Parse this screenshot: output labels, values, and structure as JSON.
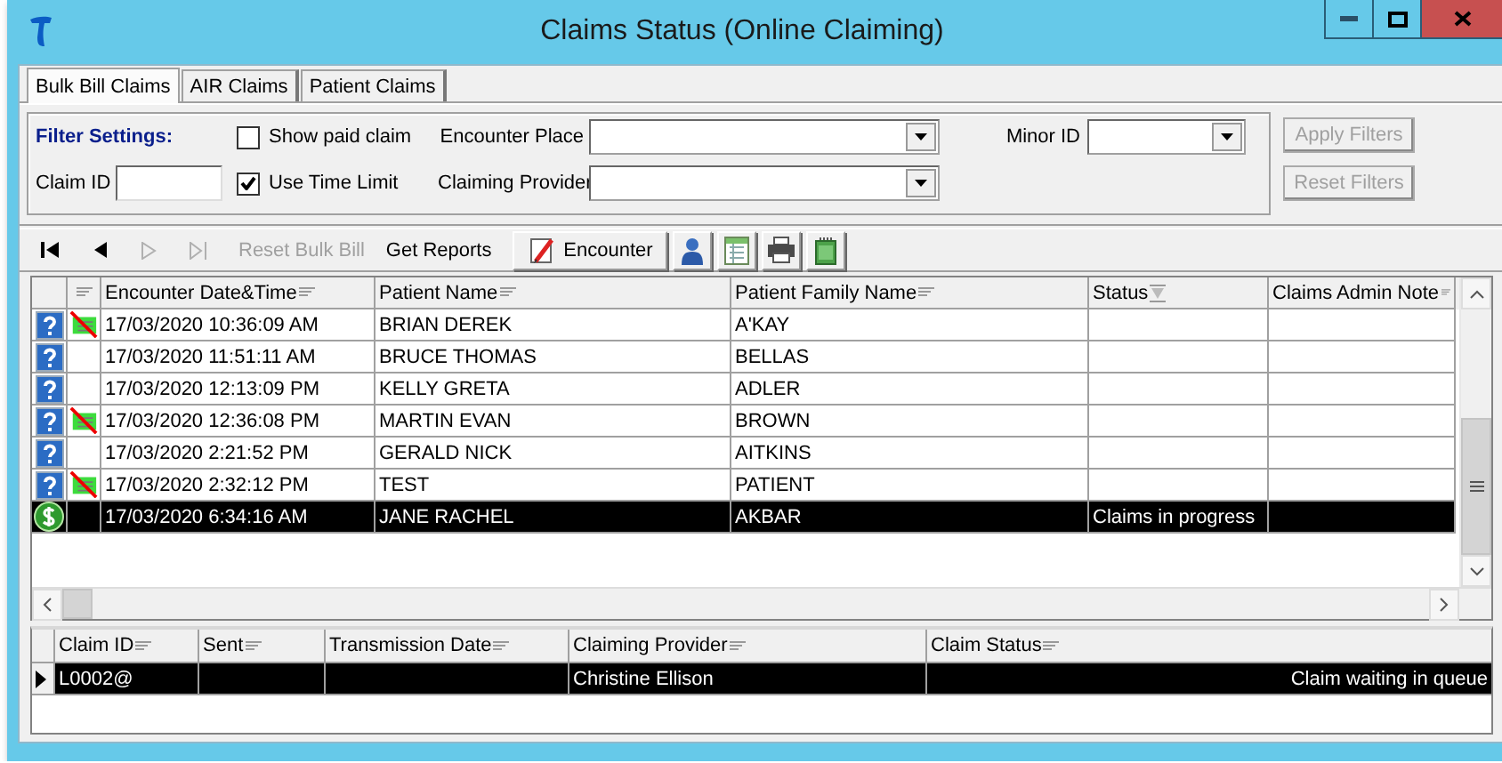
{
  "window": {
    "title": "Claims Status (Online Claiming)"
  },
  "tabs": [
    {
      "label": "Bulk Bill Claims",
      "selected": true
    },
    {
      "label": "AIR Claims",
      "selected": false
    },
    {
      "label": "Patient Claims",
      "selected": false
    }
  ],
  "filters": {
    "heading": "Filter Settings:",
    "checkboxes": [
      {
        "label": "Show paid claim",
        "checked": false
      },
      {
        "label": "Use Time Limit",
        "checked": true
      }
    ],
    "claim_id": {
      "label": "Claim ID"
    },
    "encounter_place": {
      "label": "Encounter Place"
    },
    "claiming_provider": {
      "label": "Claiming Provider"
    },
    "minor_id": {
      "label": "Minor ID"
    },
    "buttons": [
      {
        "label": "Apply Filters",
        "disabled": true
      },
      {
        "label": "Reset Filters",
        "disabled": true
      }
    ]
  },
  "toolbar": {
    "items": [
      {
        "kind": "first",
        "disabled": false
      },
      {
        "kind": "prev",
        "disabled": false
      },
      {
        "kind": "next",
        "disabled": true
      },
      {
        "kind": "last",
        "disabled": true
      },
      {
        "kind": "text",
        "label": "Reset Bulk Bill",
        "disabled": true
      },
      {
        "kind": "text",
        "label": "Get Reports",
        "disabled": false
      },
      {
        "kind": "encounter",
        "label": "Encounter",
        "disabled": false
      },
      {
        "kind": "person",
        "disabled": false
      },
      {
        "kind": "sheet",
        "disabled": false
      },
      {
        "kind": "printer",
        "disabled": false
      },
      {
        "kind": "card",
        "disabled": false
      }
    ]
  },
  "claims_grid": {
    "columns": [
      {
        "label": "Encounter Date&Time",
        "kind": "filter"
      },
      {
        "label": "Patient Name",
        "kind": "filter"
      },
      {
        "label": "Patient Family Name",
        "kind": "filter"
      },
      {
        "label": "Status",
        "kind": "sort"
      },
      {
        "label": "Claims Admin Note",
        "kind": "filter"
      }
    ],
    "rows": [
      {
        "kind": "unknown",
        "flagged": true,
        "selected": false,
        "encounter_date_time": "17/03/2020 10:36:09 AM",
        "patient_name": "BRIAN DEREK",
        "patient_family_name": "A'KAY"
      },
      {
        "kind": "unknown",
        "flagged": false,
        "selected": false,
        "encounter_date_time": "17/03/2020 11:51:11 AM",
        "patient_name": "BRUCE THOMAS",
        "patient_family_name": "BELLAS"
      },
      {
        "kind": "unknown",
        "flagged": false,
        "selected": false,
        "encounter_date_time": "17/03/2020 12:13:09 PM",
        "patient_name": "KELLY GRETA",
        "patient_family_name": "ADLER"
      },
      {
        "kind": "unknown",
        "flagged": true,
        "selected": false,
        "encounter_date_time": "17/03/2020 12:36:08 PM",
        "patient_name": "MARTIN EVAN",
        "patient_family_name": "BROWN"
      },
      {
        "kind": "unknown",
        "flagged": false,
        "selected": false,
        "encounter_date_time": "17/03/2020 2:21:52 PM",
        "patient_name": "GERALD NICK",
        "patient_family_name": "AITKINS"
      },
      {
        "kind": "unknown",
        "flagged": true,
        "selected": false,
        "encounter_date_time": "17/03/2020 2:32:12 PM",
        "patient_name": "TEST",
        "patient_family_name": "PATIENT"
      },
      {
        "kind": "paid",
        "flagged": false,
        "selected": true,
        "encounter_date_time": "17/03/2020 6:34:16 AM",
        "patient_name": "JANE RACHEL",
        "patient_family_name": "AKBAR",
        "status": "Claims in progress"
      }
    ]
  },
  "lines_grid": {
    "columns": [
      {
        "label": "Claim ID"
      },
      {
        "label": "Sent"
      },
      {
        "label": "Transmission Date"
      },
      {
        "label": "Claiming Provider"
      },
      {
        "label": "Claim Status"
      }
    ],
    "rows": [
      {
        "selected": true,
        "claim_id": "L0002@",
        "claiming_provider": "Christine Ellison",
        "claim_status": "Claim waiting in queue"
      }
    ]
  }
}
